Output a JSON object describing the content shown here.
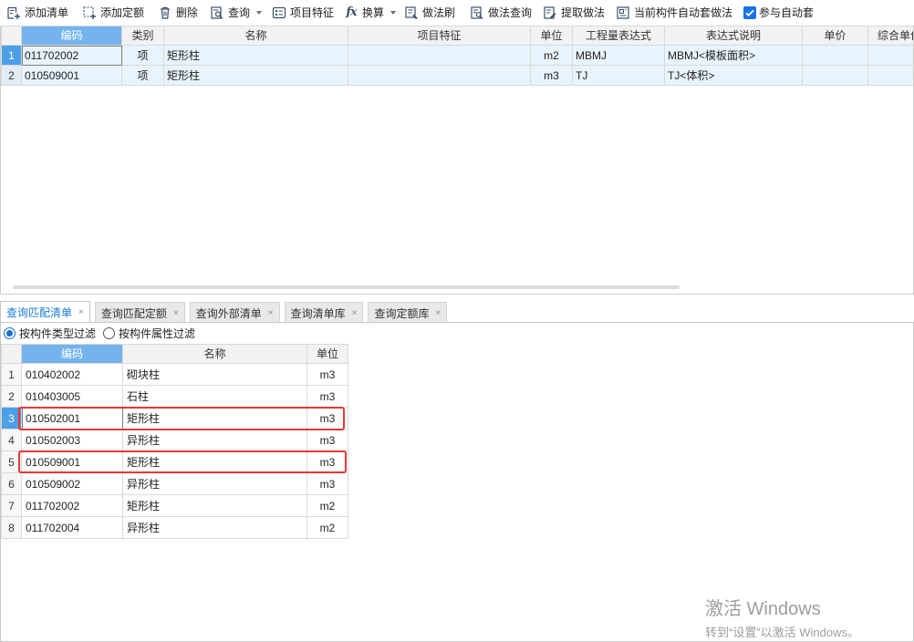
{
  "toolbar": {
    "items": [
      {
        "label": "添加清单",
        "icon": "add-list-icon"
      },
      {
        "label": "添加定额",
        "icon": "add-quota-icon"
      },
      {
        "label": "删除",
        "icon": "trash-icon"
      },
      {
        "label": "查询",
        "icon": "query-icon",
        "has_dropdown": true
      },
      {
        "label": "项目特征",
        "icon": "feature-icon"
      },
      {
        "label": "换算",
        "icon": "fx-icon",
        "glyph": "fx",
        "has_dropdown": true
      },
      {
        "label": "做法刷",
        "icon": "brush-icon"
      },
      {
        "label": "做法查询",
        "icon": "method-query-icon"
      },
      {
        "label": "提取做法",
        "icon": "extract-method-icon"
      },
      {
        "label": "当前构件自动套做法",
        "icon": "auto-apply-icon"
      }
    ],
    "auto_apply_checkbox": {
      "label": "参与自动套",
      "checked": true
    }
  },
  "upper_table": {
    "columns": [
      "编码",
      "类别",
      "名称",
      "项目特征",
      "单位",
      "工程量表达式",
      "表达式说明",
      "单价",
      "综合单价"
    ],
    "rows": [
      {
        "no": "1",
        "code": "011702002",
        "category": "项",
        "name": "矩形柱",
        "feature": "",
        "unit": "m2",
        "expression": "MBMJ",
        "expression_desc": "MBMJ<模板面积>",
        "price": "",
        "total_price": ""
      },
      {
        "no": "2",
        "code": "010509001",
        "category": "项",
        "name": "矩形柱",
        "feature": "",
        "unit": "m3",
        "expression": "TJ",
        "expression_desc": "TJ<体积>",
        "price": "",
        "total_price": ""
      }
    ]
  },
  "tabs": [
    {
      "label": "查询匹配清单",
      "active": true
    },
    {
      "label": "查询匹配定额",
      "active": false
    },
    {
      "label": "查询外部清单",
      "active": false
    },
    {
      "label": "查询清单库",
      "active": false
    },
    {
      "label": "查询定额库",
      "active": false
    }
  ],
  "tab_close_glyph": "×",
  "filters": {
    "options": [
      {
        "label": "按构件类型过滤",
        "selected": true
      },
      {
        "label": "按构件属性过滤",
        "selected": false
      }
    ]
  },
  "lower_table": {
    "columns": [
      "编码",
      "名称",
      "单位"
    ],
    "rows": [
      {
        "no": "1",
        "code": "010402002",
        "name": "砌块柱",
        "unit": "m3"
      },
      {
        "no": "2",
        "code": "010403005",
        "name": "石柱",
        "unit": "m3"
      },
      {
        "no": "3",
        "code": "010502001",
        "name": "矩形柱",
        "unit": "m3"
      },
      {
        "no": "4",
        "code": "010502003",
        "name": "异形柱",
        "unit": "m3"
      },
      {
        "no": "5",
        "code": "010509001",
        "name": "矩形柱",
        "unit": "m3"
      },
      {
        "no": "6",
        "code": "010509002",
        "name": "异形柱",
        "unit": "m3"
      },
      {
        "no": "7",
        "code": "011702002",
        "name": "矩形柱",
        "unit": "m2"
      },
      {
        "no": "8",
        "code": "011702004",
        "name": "异形柱",
        "unit": "m2"
      }
    ]
  },
  "colors": {
    "accent": "#1a7bd6",
    "header_highlight": "#74b3ec",
    "selected_row_marker": "#4d9fe8",
    "row_tint": "#e8f4fd",
    "annotation": "#e53935"
  },
  "watermark": {
    "title": "激活 Windows",
    "subtitle": "转到“设置”以激活 Windows。"
  }
}
